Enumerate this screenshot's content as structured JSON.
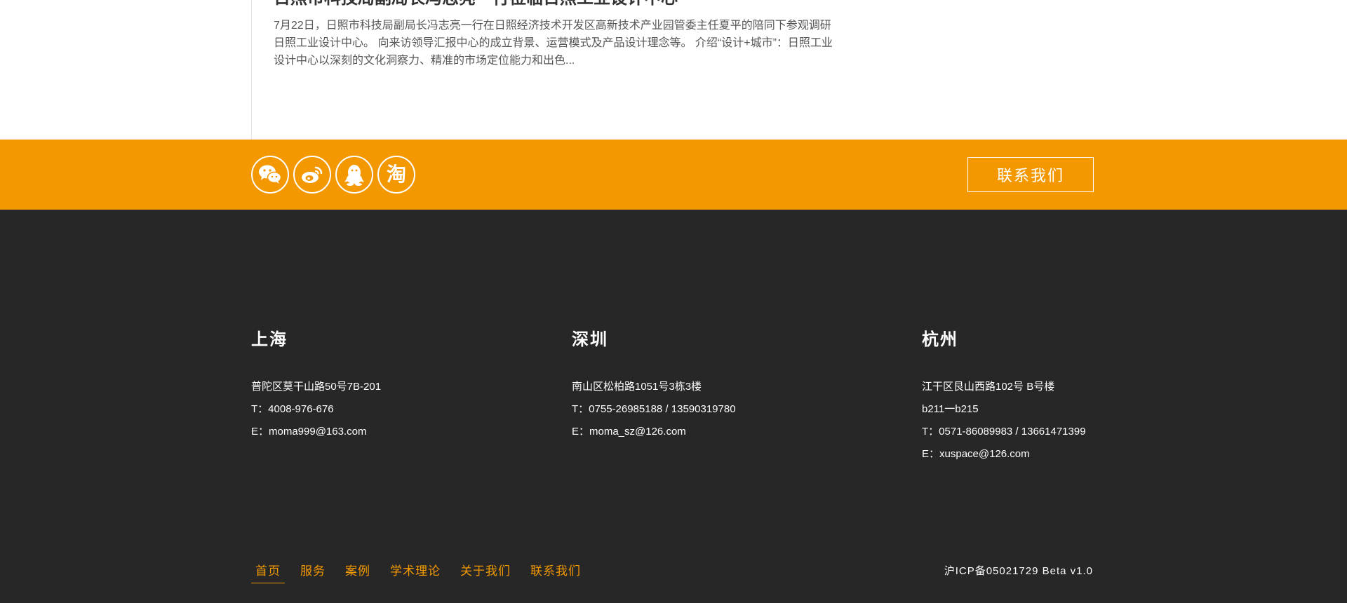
{
  "news": {
    "title": "日照市科技局副局长冯志亮一行莅临日照工业设计中心",
    "excerpt": "7月22日，日照市科技局副局长冯志亮一行在日照经济技术开发区高新技术产业园管委主任夏平的陪同下参观调研日照工业设计中心。 向来访领导汇报中心的成立背景、运营模式及产品设计理念等。 介绍“设计+城市”：日照工业设计中心以深刻的文化洞察力、精准的市场定位能力和出色..."
  },
  "social": {
    "icons": [
      "wechat-icon",
      "weibo-icon",
      "qq-icon",
      "taobao-icon"
    ],
    "taobao_glyph": "淘"
  },
  "contact_button": {
    "label": "联系我们"
  },
  "offices": [
    {
      "city": "上海",
      "lines": [
        "普陀区莫干山路50号7B-201",
        "T：4008-976-676",
        "E：moma999@163.com"
      ]
    },
    {
      "city": "深圳",
      "lines": [
        "南山区松柏路1051号3栋3楼",
        "T：0755-26985188 / 13590319780",
        "E：moma_sz@126.com"
      ]
    },
    {
      "city": "杭州",
      "lines": [
        "江干区艮山西路102号 B号楼",
        "b211一b215",
        "T：0571-86089983 / 13661471399",
        "E：xuspace@126.com"
      ]
    }
  ],
  "footer_nav": {
    "items": [
      "首页",
      "服务",
      "案例",
      "学术理论",
      "关于我们",
      "联系我们"
    ],
    "active": "首页"
  },
  "icp": "沪ICP备05021729 Beta v1.0",
  "colors": {
    "accent": "#f39800",
    "footer_bg": "#272727",
    "text_dark": "#333333"
  }
}
